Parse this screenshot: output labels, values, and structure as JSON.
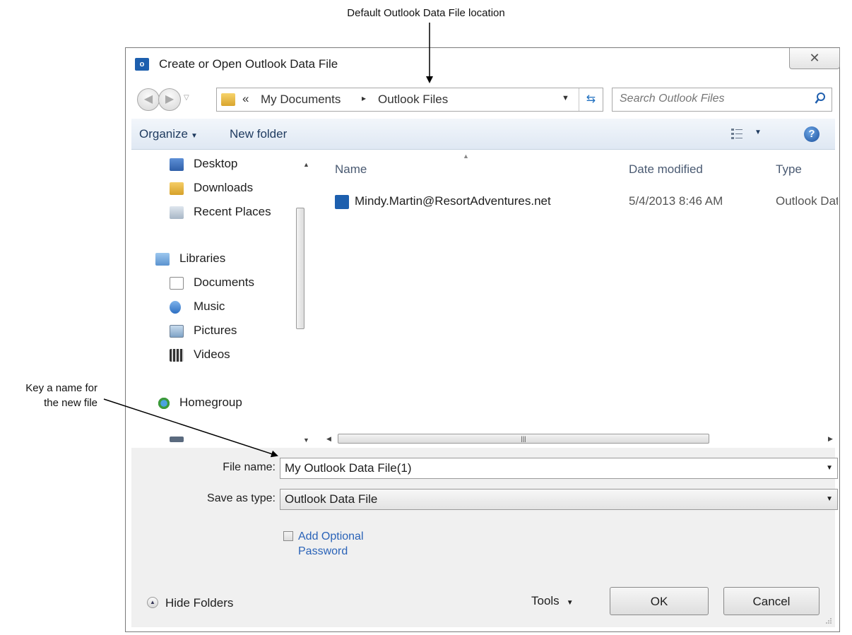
{
  "annotations": {
    "top_callout": "Default Outlook Data File location",
    "left_callout_line1": "Key a name for",
    "left_callout_line2": "the new file"
  },
  "dialog": {
    "title": "Create or Open Outlook Data File",
    "close_glyph": "✕",
    "address": {
      "prefix": "«",
      "segments": [
        "My Documents",
        "Outlook Files"
      ],
      "separator": "▸"
    },
    "search_placeholder": "Search Outlook Files",
    "toolbar": {
      "organize": "Organize",
      "new_folder": "New folder"
    },
    "nav": [
      {
        "label": "Desktop",
        "icon": "desktop-icon"
      },
      {
        "label": "Downloads",
        "icon": "downloads-icon"
      },
      {
        "label": "Recent Places",
        "icon": "recent-places-icon"
      },
      {
        "label": "Libraries",
        "icon": "libraries-icon"
      },
      {
        "label": "Documents",
        "icon": "documents-icon"
      },
      {
        "label": "Music",
        "icon": "music-icon"
      },
      {
        "label": "Pictures",
        "icon": "pictures-icon"
      },
      {
        "label": "Videos",
        "icon": "videos-icon"
      },
      {
        "label": "Homegroup",
        "icon": "homegroup-icon"
      }
    ],
    "columns": {
      "name": "Name",
      "date": "Date modified",
      "type": "Type"
    },
    "files": [
      {
        "name": "Mindy.Martin@ResortAdventures.net",
        "date": "5/4/2013 8:46 AM",
        "type": "Outlook Data"
      }
    ],
    "file_name_label": "File name:",
    "file_name_value": "My Outlook Data File(1)",
    "save_type_label": "Save as type:",
    "save_type_value": "Outlook Data File",
    "password_line1": "Add Optional",
    "password_line2": "Password",
    "hide_folders": "Hide Folders",
    "tools": "Tools",
    "ok": "OK",
    "cancel": "Cancel"
  },
  "colors": {
    "toolbar_bg": "#dfe8f3",
    "link": "#2a63b8",
    "bottom_panel": "#f0f0f0"
  }
}
